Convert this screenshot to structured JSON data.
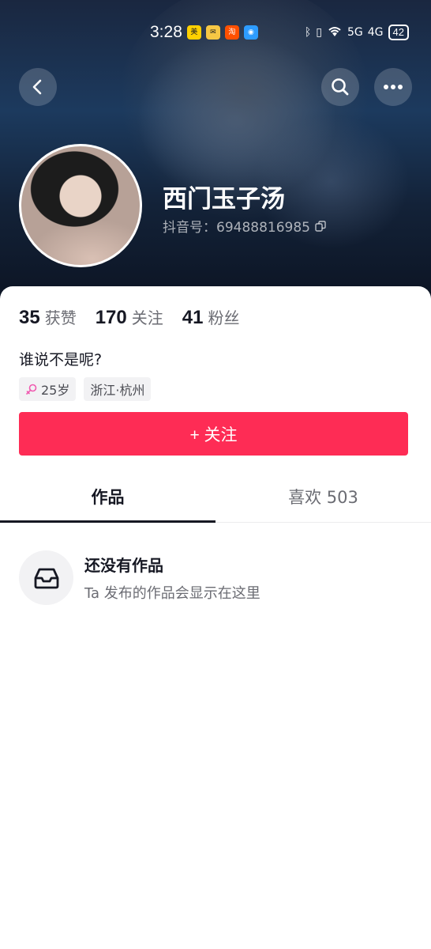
{
  "status_bar": {
    "time": "3:28",
    "apps": [
      "美团",
      "邮件",
      "淘",
      "浏览器"
    ],
    "network_1": "5G",
    "network_2": "4G",
    "battery": "42"
  },
  "header": {
    "back_icon": "chevron-left-icon",
    "search_icon": "search-icon",
    "more_icon": "more-horizontal-icon",
    "name": "西门玉子汤",
    "uid_label": "抖音号：69488816985"
  },
  "stats": {
    "likes_num": "35",
    "likes_label": "获赞",
    "following_num": "170",
    "following_label": "关注",
    "followers_num": "41",
    "followers_label": "粉丝"
  },
  "bio": "谁说不是呢?",
  "tags": {
    "age": "25岁",
    "location": "浙江·杭州"
  },
  "follow_button": "+ 关注",
  "tabs": {
    "works": "作品",
    "likes": "喜欢 503"
  },
  "empty": {
    "title": "还没有作品",
    "subtitle": "Ta 发布的作品会显示在这里"
  },
  "colors": {
    "accent": "#fe2c55",
    "text_primary": "#161823",
    "text_secondary": "#6b6c73"
  }
}
